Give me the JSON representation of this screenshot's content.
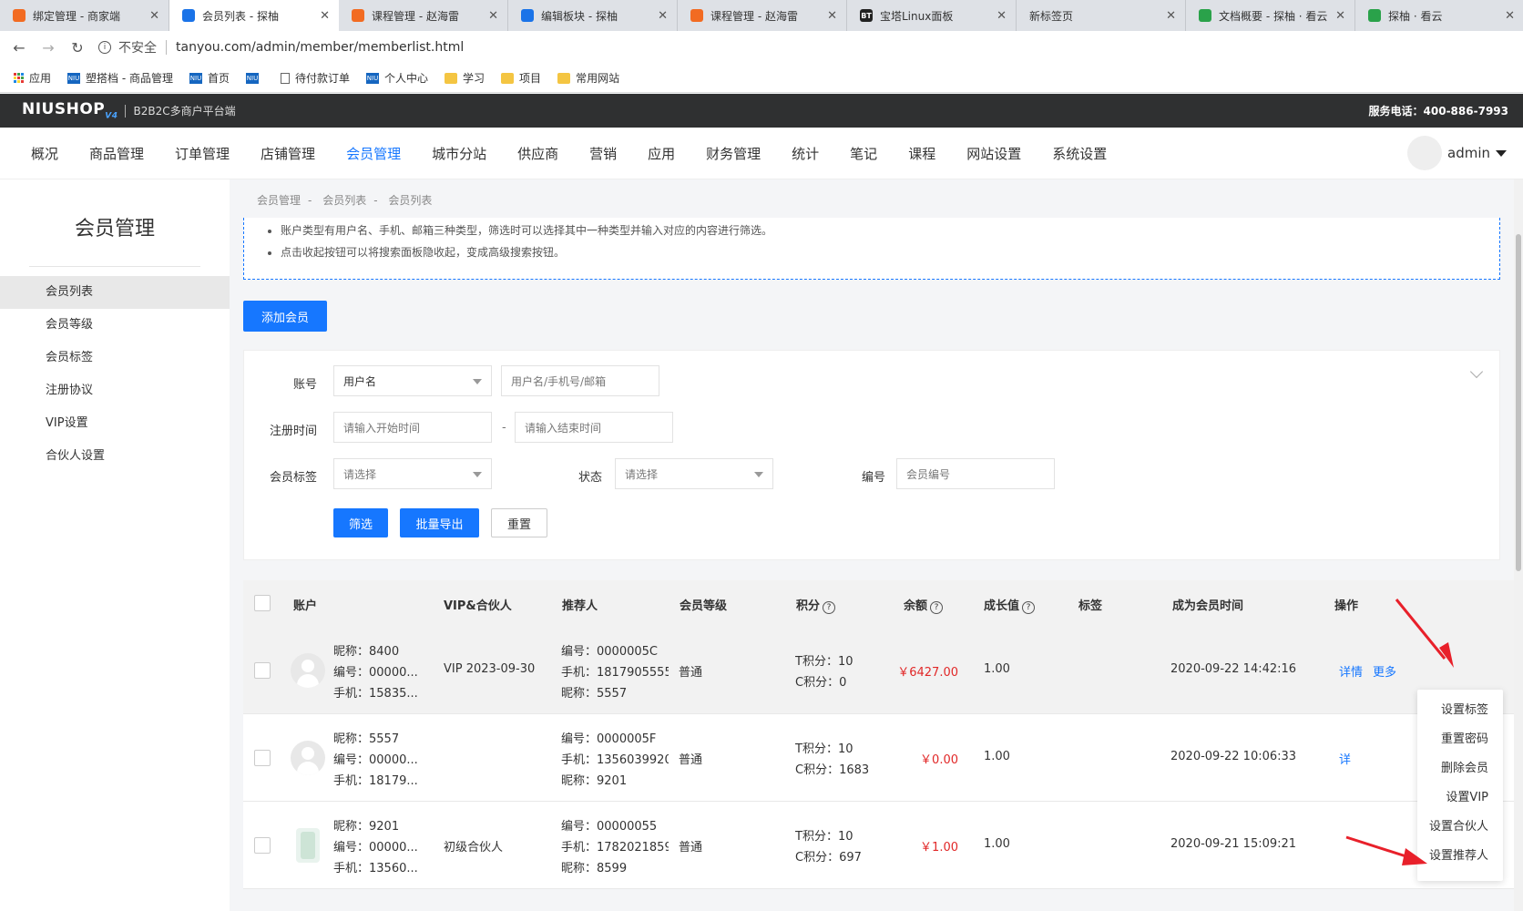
{
  "browser": {
    "tabs": [
      {
        "title": "绑定管理 - 商家端",
        "color": "#f26b22",
        "active": false
      },
      {
        "title": "会员列表 - 探柚",
        "color": "#1a73e8",
        "active": true
      },
      {
        "title": "课程管理 - 赵海雷",
        "color": "#f26b22",
        "active": false
      },
      {
        "title": "编辑板块 - 探柚",
        "color": "#1a73e8",
        "active": false
      },
      {
        "title": "课程管理 - 赵海雷",
        "color": "#f26b22",
        "active": false
      },
      {
        "title": "宝塔Linux面板",
        "color": "#222222",
        "active": false
      },
      {
        "title": "新标签页",
        "color": "",
        "active": false
      },
      {
        "title": "文档概要 - 探柚 · 看云",
        "color": "#2aa24a",
        "active": false
      },
      {
        "title": "探柚 · 看云",
        "color": "#2aa24a",
        "active": false
      }
    ],
    "url_security": "不安全",
    "url": "tanyou.com/admin/member/memberlist.html",
    "bookmarks": [
      {
        "label": "应用",
        "icon": "apps-icon"
      },
      {
        "label": "塑搭档 - 商品管理",
        "icon": "niu-icon"
      },
      {
        "label": "首页",
        "icon": "niu-icon"
      },
      {
        "label": "",
        "icon": "niu-icon"
      },
      {
        "label": "待付款订单",
        "icon": "page-icon"
      },
      {
        "label": "个人中心",
        "icon": "niu-icon"
      },
      {
        "label": "学习",
        "icon": "folder-icon"
      },
      {
        "label": "项目",
        "icon": "folder-icon"
      },
      {
        "label": "常用网站",
        "icon": "folder-icon"
      }
    ]
  },
  "header": {
    "logo": "NIUSHOP",
    "logo_version": "V4",
    "platform": "B2B2C多商户平台端",
    "phone": "服务电话：400-886-7993"
  },
  "nav": {
    "items": [
      "概况",
      "商品管理",
      "订单管理",
      "店铺管理",
      "会员管理",
      "城市分站",
      "供应商",
      "营销",
      "应用",
      "财务管理",
      "统计",
      "笔记",
      "课程",
      "网站设置",
      "系统设置"
    ],
    "active": "会员管理",
    "user": "admin"
  },
  "sidebar": {
    "title": "会员管理",
    "items": [
      "会员列表",
      "会员等级",
      "会员标签",
      "注册协议",
      "VIP设置",
      "合伙人设置"
    ],
    "active": "会员列表"
  },
  "breadcrumb": [
    "会员管理",
    "会员列表",
    "会员列表"
  ],
  "tips": [
    "账户类型有用户名、手机、邮箱三种类型，筛选时可以选择其中一种类型并输入对应的内容进行筛选。",
    "点击收起按钮可以将搜索面板隐收起，变成高级搜索按钮。"
  ],
  "add_button": "添加会员",
  "filter": {
    "account_label": "账号",
    "account_type": "用户名",
    "account_placeholder": "用户名/手机号/邮箱",
    "time_label": "注册时间",
    "start_placeholder": "请输入开始时间",
    "time_sep": "-",
    "end_placeholder": "请输入结束时间",
    "tag_label": "会员标签",
    "tag_value": "请选择",
    "status_label": "状态",
    "status_value": "请选择",
    "no_label": "编号",
    "no_placeholder": "会员编号",
    "filter_btn": "筛选",
    "export_btn": "批量导出",
    "reset_btn": "重置"
  },
  "table": {
    "headers": [
      "账户",
      "VIP&合伙人",
      "推荐人",
      "会员等级",
      "积分",
      "余额",
      "成长值",
      "标签",
      "成为会员时间",
      "操作"
    ],
    "rows": [
      {
        "nickname": "昵称：8400",
        "no": "编号：00000...",
        "phone": "手机：15835...",
        "vip": "VIP 2023-09-30",
        "ref_no": "编号：0000005C",
        "ref_phone": "手机：1817905555",
        "ref_nick": "昵称：5557",
        "level": "普通",
        "t_points": "T积分：10",
        "c_points": "C积分：0",
        "balance": "￥6427.00",
        "growth": "1.00",
        "time": "2020-09-22 14:42:16",
        "avatar": "default"
      },
      {
        "nickname": "昵称：5557",
        "no": "编号：00000...",
        "phone": "手机：18179...",
        "vip": "",
        "ref_no": "编号：0000005F",
        "ref_phone": "手机：1356039920",
        "ref_nick": "昵称：9201",
        "level": "普通",
        "t_points": "T积分：10",
        "c_points": "C积分：1683",
        "balance": "￥0.00",
        "growth": "1.00",
        "time": "2020-09-22 10:06:33",
        "avatar": "default"
      },
      {
        "nickname": "昵称：9201",
        "no": "编号：00000...",
        "phone": "手机：13560...",
        "vip": "初级合伙人",
        "ref_no": "编号：00000055",
        "ref_phone": "手机：1782021859",
        "ref_nick": "昵称：8599",
        "level": "普通",
        "t_points": "T积分：10",
        "c_points": "C积分：697",
        "balance": "￥1.00",
        "growth": "1.00",
        "time": "2020-09-21 15:09:21",
        "avatar": "photo"
      }
    ],
    "action_detail": "详情",
    "action_more": "更多",
    "row2_detail_partial": "详"
  },
  "more_menu": [
    "设置标签",
    "重置密码",
    "删除会员",
    "设置VIP",
    "设置合伙人",
    "设置推荐人"
  ],
  "colors": {
    "accent": "#1677ff",
    "price": "#e12828",
    "annotation": "#e8202a"
  }
}
